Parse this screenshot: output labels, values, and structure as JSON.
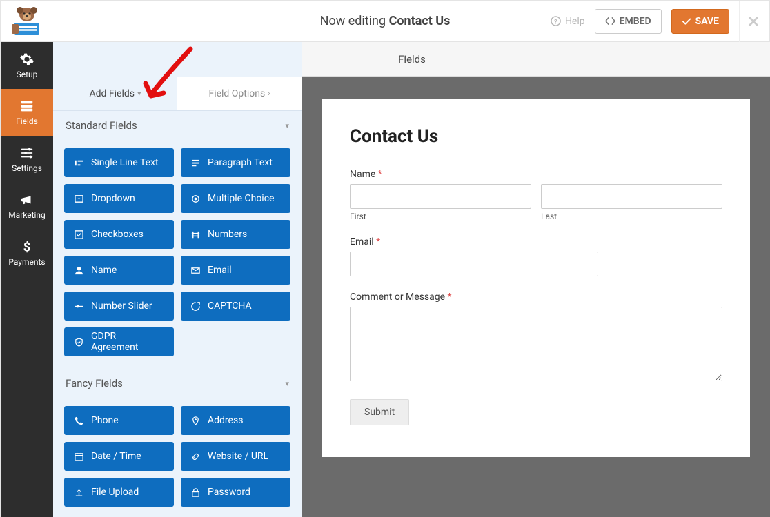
{
  "topbar": {
    "title_prefix": "Now editing ",
    "title_name": "Contact Us",
    "help": "Help",
    "embed": "EMBED",
    "save": "SAVE"
  },
  "rail": {
    "items": [
      {
        "label": "Setup"
      },
      {
        "label": "Fields"
      },
      {
        "label": "Settings"
      },
      {
        "label": "Marketing"
      },
      {
        "label": "Payments"
      }
    ]
  },
  "fields_header": "Fields",
  "panel": {
    "tab_add": "Add Fields",
    "tab_options": "Field Options",
    "section_standard": "Standard Fields",
    "standard": [
      "Single Line Text",
      "Paragraph Text",
      "Dropdown",
      "Multiple Choice",
      "Checkboxes",
      "Numbers",
      "Name",
      "Email",
      "Number Slider",
      "CAPTCHA",
      "GDPR Agreement"
    ],
    "section_fancy": "Fancy Fields",
    "fancy": [
      "Phone",
      "Address",
      "Date / Time",
      "Website / URL",
      "File Upload",
      "Password"
    ]
  },
  "form": {
    "title": "Contact Us",
    "name_label": "Name",
    "first": "First",
    "last": "Last",
    "email_label": "Email",
    "msg_label": "Comment or Message",
    "submit": "Submit",
    "required_mark": "*"
  }
}
